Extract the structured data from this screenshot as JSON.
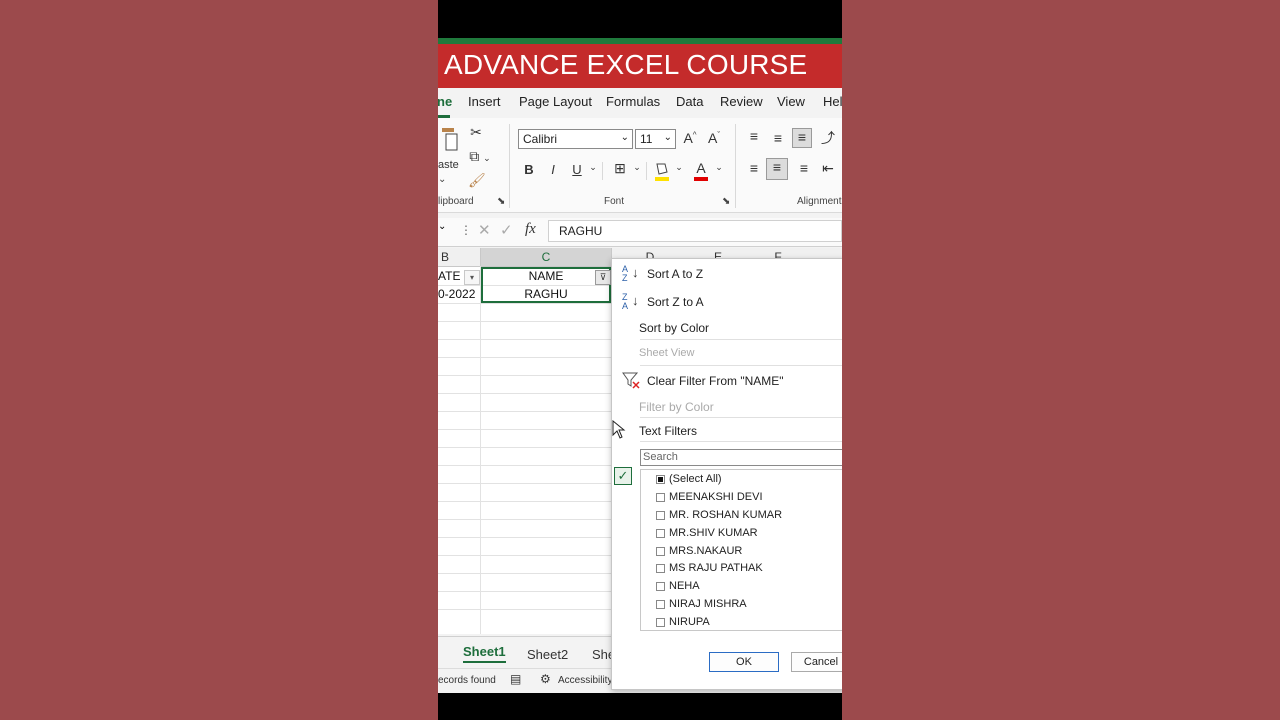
{
  "banner": {
    "title": "ADVANCE EXCEL COURSE"
  },
  "tabs": [
    "ne",
    "Insert",
    "Page Layout",
    "Formulas",
    "Data",
    "Review",
    "View",
    "Hel"
  ],
  "ribbon": {
    "paste_label": "aste",
    "clipboard_label": "lipboard",
    "font_name": "Calibri",
    "font_size": "11",
    "font_group_label": "Font",
    "alignment_label": "Alignment",
    "bold": "B",
    "italic": "I",
    "underline": "U"
  },
  "formula_bar": {
    "fx": "fx",
    "value": "RAGHU"
  },
  "grid": {
    "columns": [
      "B",
      "C",
      "D",
      "E",
      "F"
    ],
    "header_row": {
      "b": "ATE",
      "c": "NAME"
    },
    "row2": {
      "b": "0-2022",
      "c": "RAGHU"
    }
  },
  "filter_menu": {
    "sort_az": "Sort A to Z",
    "sort_za": "Sort Z to A",
    "sort_color": "Sort by Color",
    "sheet_view": "Sheet View",
    "clear_filter": "Clear Filter From \"NAME\"",
    "filter_color": "Filter by Color",
    "text_filters": "Text Filters",
    "search_placeholder": "Search",
    "items": [
      "(Select All)",
      "MEENAKSHI DEVI",
      "MR. ROSHAN KUMAR",
      "MR.SHIV KUMAR",
      "MRS.NAKAUR",
      "MS RAJU PATHAK",
      "NEHA",
      "NIRAJ MISHRA",
      "NIRUPA"
    ],
    "ok": "OK",
    "cancel": "Cancel"
  },
  "sheets": [
    "Sheet1",
    "Sheet2",
    "She"
  ],
  "status": {
    "records": "ecords found",
    "accessibility": "Accessibility"
  },
  "colors": {
    "banner": "#c42b2b",
    "excel_green": "#1e6e3c",
    "background": "#9c4a4c"
  }
}
